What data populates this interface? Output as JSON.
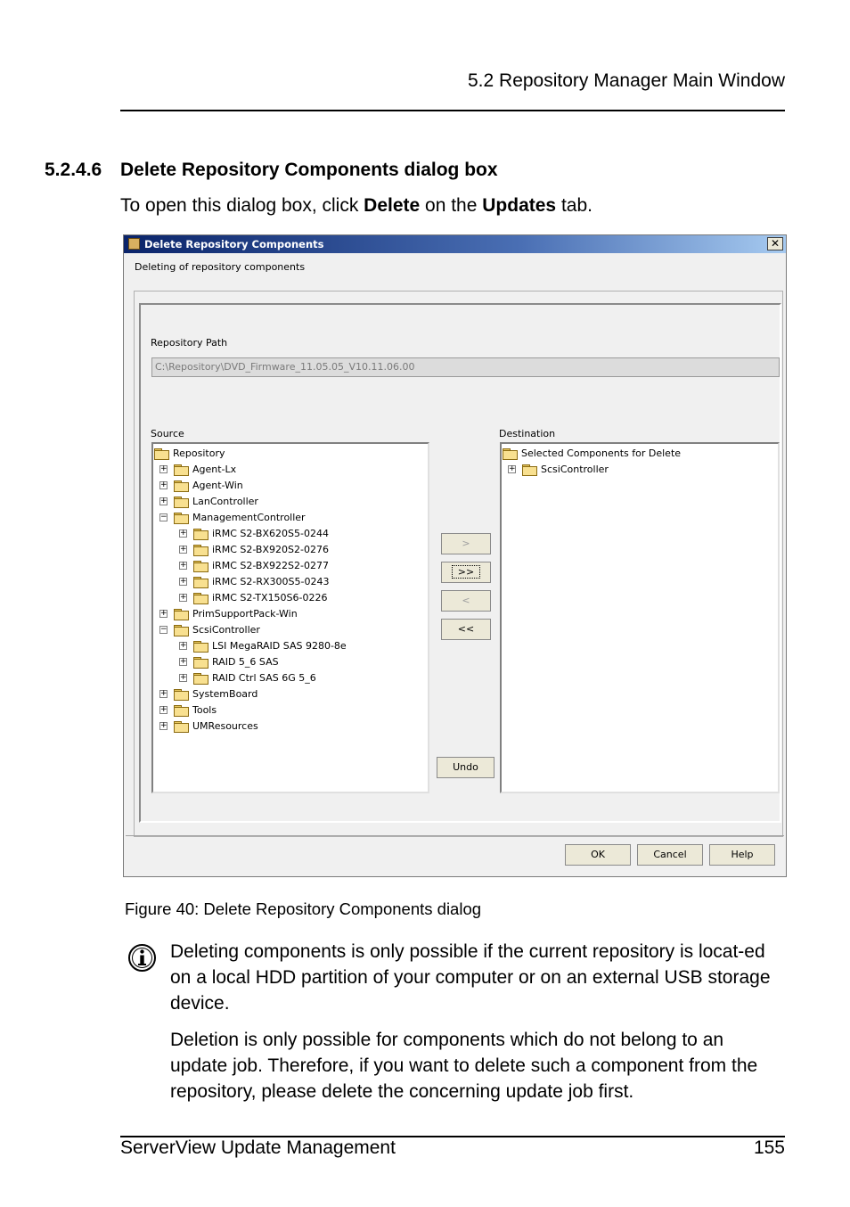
{
  "header": {
    "running_title": "5.2 Repository Manager Main Window"
  },
  "section": {
    "number": "5.2.4.6",
    "title": "Delete Repository Components dialog box",
    "intro_prefix": "To open this dialog box, click ",
    "intro_delete": "Delete",
    "intro_middle": " on the ",
    "intro_tab": "Updates",
    "intro_suffix": " tab."
  },
  "dialog": {
    "title": "Delete Repository Components",
    "close_glyph": "✕",
    "subtitle": "Deleting of repository components",
    "repo_path_label": "Repository Path",
    "repo_path_value": "C:\\Repository\\DVD_Firmware_11.05.05_V10.11.06.00",
    "source_label": "Source",
    "destination_label": "Destination",
    "source_tree": [
      {
        "label": "Repository",
        "level": 0,
        "expander": ""
      },
      {
        "label": "Agent-Lx",
        "level": 1,
        "expander": "+"
      },
      {
        "label": "Agent-Win",
        "level": 1,
        "expander": "+"
      },
      {
        "label": "LanController",
        "level": 1,
        "expander": "+"
      },
      {
        "label": "ManagementController",
        "level": 1,
        "expander": "-"
      },
      {
        "label": "iRMC S2-BX620S5-0244",
        "level": 2,
        "expander": "+"
      },
      {
        "label": "iRMC S2-BX920S2-0276",
        "level": 2,
        "expander": "+"
      },
      {
        "label": "iRMC S2-BX922S2-0277",
        "level": 2,
        "expander": "+"
      },
      {
        "label": "iRMC S2-RX300S5-0243",
        "level": 2,
        "expander": "+"
      },
      {
        "label": "iRMC S2-TX150S6-0226",
        "level": 2,
        "expander": "+"
      },
      {
        "label": "PrimSupportPack-Win",
        "level": 1,
        "expander": "+"
      },
      {
        "label": "ScsiController",
        "level": 1,
        "expander": "-"
      },
      {
        "label": "LSI MegaRAID SAS 9280-8e",
        "level": 2,
        "expander": "+"
      },
      {
        "label": "RAID 5_6 SAS",
        "level": 2,
        "expander": "+"
      },
      {
        "label": "RAID Ctrl SAS 6G 5_6",
        "level": 2,
        "expander": "+"
      },
      {
        "label": "SystemBoard",
        "level": 1,
        "expander": "+"
      },
      {
        "label": "Tools",
        "level": 1,
        "expander": "+"
      },
      {
        "label": "UMResources",
        "level": 1,
        "expander": "+"
      }
    ],
    "destination_tree": [
      {
        "label": "Selected Components for Delete",
        "level": 0,
        "expander": ""
      },
      {
        "label": "ScsiController",
        "level": 1,
        "expander": "+"
      }
    ],
    "move_buttons": {
      "add": ">",
      "add_all": ">>",
      "remove": "<",
      "remove_all": "<<"
    },
    "undo_label": "Undo",
    "ok_label": "OK",
    "cancel_label": "Cancel",
    "help_label": "Help"
  },
  "figure": {
    "caption": "Figure 40: Delete Repository Components dialog"
  },
  "note": {
    "icon": "info-icon",
    "para1": "Deleting components is only possible if the current repository is locat-ed on a local HDD partition of your computer or on an external USB storage device.",
    "para2": "Deletion is only possible for components which do not belong to an update job. Therefore, if you want to delete such a component from the repository, please delete the concerning update job first."
  },
  "footer": {
    "product": "ServerView Update Management",
    "page_number": "155"
  }
}
